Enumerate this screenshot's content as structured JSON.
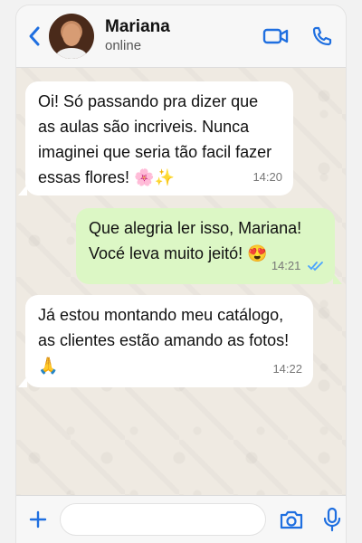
{
  "header": {
    "name": "Mariana",
    "status": "online"
  },
  "messages": [
    {
      "direction": "in",
      "line1": "Oi! Só passando pra dizer que",
      "line2": "as aulas são incriveis. Nunca",
      "line3": "imaginei que seria tão facil fazer",
      "line4": "essas flores! 🌸✨",
      "time": "14:20"
    },
    {
      "direction": "out",
      "line1": "Que alegria ler isso, Mariana!",
      "line2": "Vocé leva muito jeitó! 😍",
      "time": "14:21"
    },
    {
      "direction": "in",
      "line1": "Já estou montando meu catálogo,",
      "line2": "as clientes estão amando as fotos!",
      "line3": "🙏",
      "time": "14:22"
    }
  ],
  "composer": {
    "placeholder": ""
  },
  "colors": {
    "accent": "#1f6fe0",
    "incoming": "#ffffff",
    "outgoing": "#dcf7c5",
    "read_check": "#4aa3ff"
  },
  "icons": {
    "back": "chevron-left-icon",
    "video": "video-call-icon",
    "phone": "phone-icon",
    "add": "plus-icon",
    "camera": "camera-icon",
    "mic": "microphone-icon",
    "read": "double-check-icon"
  }
}
